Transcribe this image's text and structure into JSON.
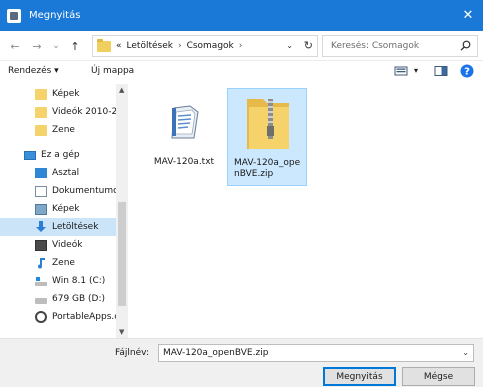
{
  "window": {
    "title": "Megnyitás",
    "close_glyph": "✕"
  },
  "nav": {
    "back": "←",
    "forward": "→",
    "history": "⌄",
    "up": "↑"
  },
  "address": {
    "overflow": "«",
    "crumbs": [
      "Letöltések",
      "Csomagok"
    ],
    "separator": "›",
    "dropdown": "⌄",
    "refresh": "↻"
  },
  "search": {
    "placeholder": "Keresés: Csomagok"
  },
  "toolbar": {
    "organize": "Rendezés ▾",
    "new_folder": "Új mappa",
    "view_dd": "▾",
    "help": "?"
  },
  "sidebar": {
    "items": [
      {
        "label": "Képek",
        "icon": "folder-icon"
      },
      {
        "label": "Videók 2010-201",
        "icon": "folder-icon"
      },
      {
        "label": "Zene",
        "icon": "folder-icon"
      },
      {
        "label": "Ez a gép",
        "icon": "computer-icon"
      },
      {
        "label": "Asztal",
        "icon": "desktop-icon"
      },
      {
        "label": "Dokumentumok",
        "icon": "documents-icon"
      },
      {
        "label": "Képek",
        "icon": "pictures-icon"
      },
      {
        "label": "Letöltések",
        "icon": "downloads-icon"
      },
      {
        "label": "Videók",
        "icon": "videos-icon"
      },
      {
        "label": "Zene",
        "icon": "music-icon"
      },
      {
        "label": "Win 8.1 (C:)",
        "icon": "drive-icon"
      },
      {
        "label": "679 GB (D:)",
        "icon": "drive-icon"
      },
      {
        "label": "PortableApps.co",
        "icon": "portableapps-icon"
      }
    ],
    "scroll_up": "▲",
    "scroll_down": "▼"
  },
  "files": [
    {
      "name": "MAV-120a.txt",
      "icon": "text-file-icon"
    },
    {
      "name": "MAV-120a_openBVE.zip",
      "icon": "zip-folder-icon"
    }
  ],
  "bottom": {
    "filename_label": "Fájlnév:",
    "filename_value": "MAV-120a_openBVE.zip",
    "dropdown": "⌄",
    "open_label": "Megnyitás",
    "cancel_label": "Mégse"
  },
  "colors": {
    "titlebar": "#1a78d6",
    "selection": "#cce4f7",
    "tile_selection": "#cce8ff",
    "folder": "#f6d36a",
    "help": "#1a73e8"
  }
}
